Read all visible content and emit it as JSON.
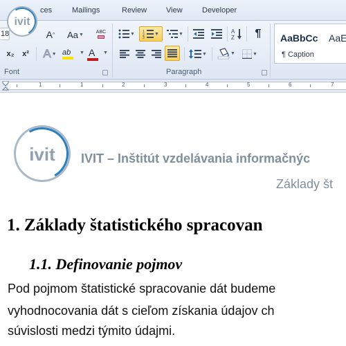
{
  "tabs": [
    {
      "label": "ces"
    },
    {
      "label": "Mailings"
    },
    {
      "label": "Review"
    },
    {
      "label": "View"
    },
    {
      "label": "Developer"
    }
  ],
  "font_group": {
    "label": "Font",
    "font_size": "18",
    "grow_font": "A",
    "shrink_font": "A",
    "change_case": "Aa",
    "clear_format": "ABC",
    "subscript": "x₂",
    "superscript": "x²",
    "text_effects": "A",
    "highlight": "ab",
    "font_color": "A",
    "highlight_color": "#f6e400",
    "font_color_value": "#c0181c"
  },
  "paragraph_group": {
    "label": "Paragraph",
    "pilcrow": "¶"
  },
  "styles": [
    {
      "preview": "AaBbCc",
      "name": "¶ Caption"
    },
    {
      "preview": "AaE",
      "name": ""
    }
  ],
  "ruler": {
    "numbers": [
      "1",
      "1",
      "2",
      "3",
      "4",
      "5",
      "6",
      "7",
      "8"
    ]
  },
  "logo": {
    "text": "ivit",
    "accent": "#2a7fc1",
    "gray": "#8fa0b2"
  },
  "document": {
    "header_title": "IVIT – Inštitút vzdelávania informačnýc",
    "header_subtitle": "Základy št",
    "heading1": "1. Základy štatistického spracovan",
    "heading2": "1.1. Definovanie pojmov",
    "body_lines": [
      "Pod pojmom štatistické spracovanie dát budeme",
      "vyhodnocovania  dát  s cieľom  získania  údajov  ch",
      "súvislosti medzi týmito údajmi."
    ]
  }
}
